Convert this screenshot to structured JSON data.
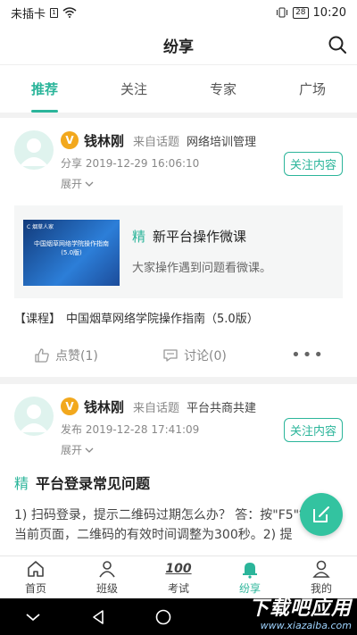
{
  "status_bar": {
    "carrier": "未插卡",
    "sim_glyph": "1",
    "battery": "28",
    "time": "10:20"
  },
  "header": {
    "title": "纷享"
  },
  "tabs": [
    {
      "label": "推荐",
      "active": true
    },
    {
      "label": "关注",
      "active": false
    },
    {
      "label": "专家",
      "active": false
    },
    {
      "label": "广场",
      "active": false
    }
  ],
  "posts": [
    {
      "badge": "V",
      "author": "钱林刚",
      "from_label": "来自话题",
      "topic": "网络培训管理",
      "time": "分享 2019-12-29 16:06:10",
      "expand": "展开",
      "follow": "关注内容",
      "course": {
        "thumb_tag": "C 烟草人家",
        "thumb_title": "中国烟草网络学院操作指南(5.0版)",
        "jing": "精",
        "title": "新平台操作微课",
        "desc": "大家操作遇到问题看微课。"
      },
      "course_line_tag": "【课程】",
      "course_line_text": "中国烟草网络学院操作指南（5.0版）",
      "like": "点赞(1)",
      "comment": "讨论(0)",
      "more": "•••"
    },
    {
      "badge": "V",
      "author": "钱林刚",
      "from_label": "来自话题",
      "topic": "平台共商共建",
      "time": "发布 2019-12-28 17:41:09",
      "expand": "展开",
      "follow": "关注内容",
      "jing": "精",
      "title": "平台登录常见问题",
      "body": "1) 扫码登录，提示二维码过期怎么办？ 答：按\"F5\"键刷新当前页面，二维码的有效时间调整为300秒。2) 提"
    }
  ],
  "bottom_nav": [
    {
      "label": "首页",
      "icon": "home-icon"
    },
    {
      "label": "班级",
      "icon": "class-icon"
    },
    {
      "label": "考试",
      "icon": "exam-icon",
      "glyph": "100"
    },
    {
      "label": "纷享",
      "icon": "bell-icon",
      "active": true
    },
    {
      "label": "我的",
      "icon": "profile-icon"
    }
  ],
  "watermark": {
    "big": "下载吧应用",
    "small": "www.xiazaiba.com"
  },
  "colors": {
    "accent": "#2bb59a",
    "badge": "#f2a81d",
    "fab": "#33c3a0"
  }
}
